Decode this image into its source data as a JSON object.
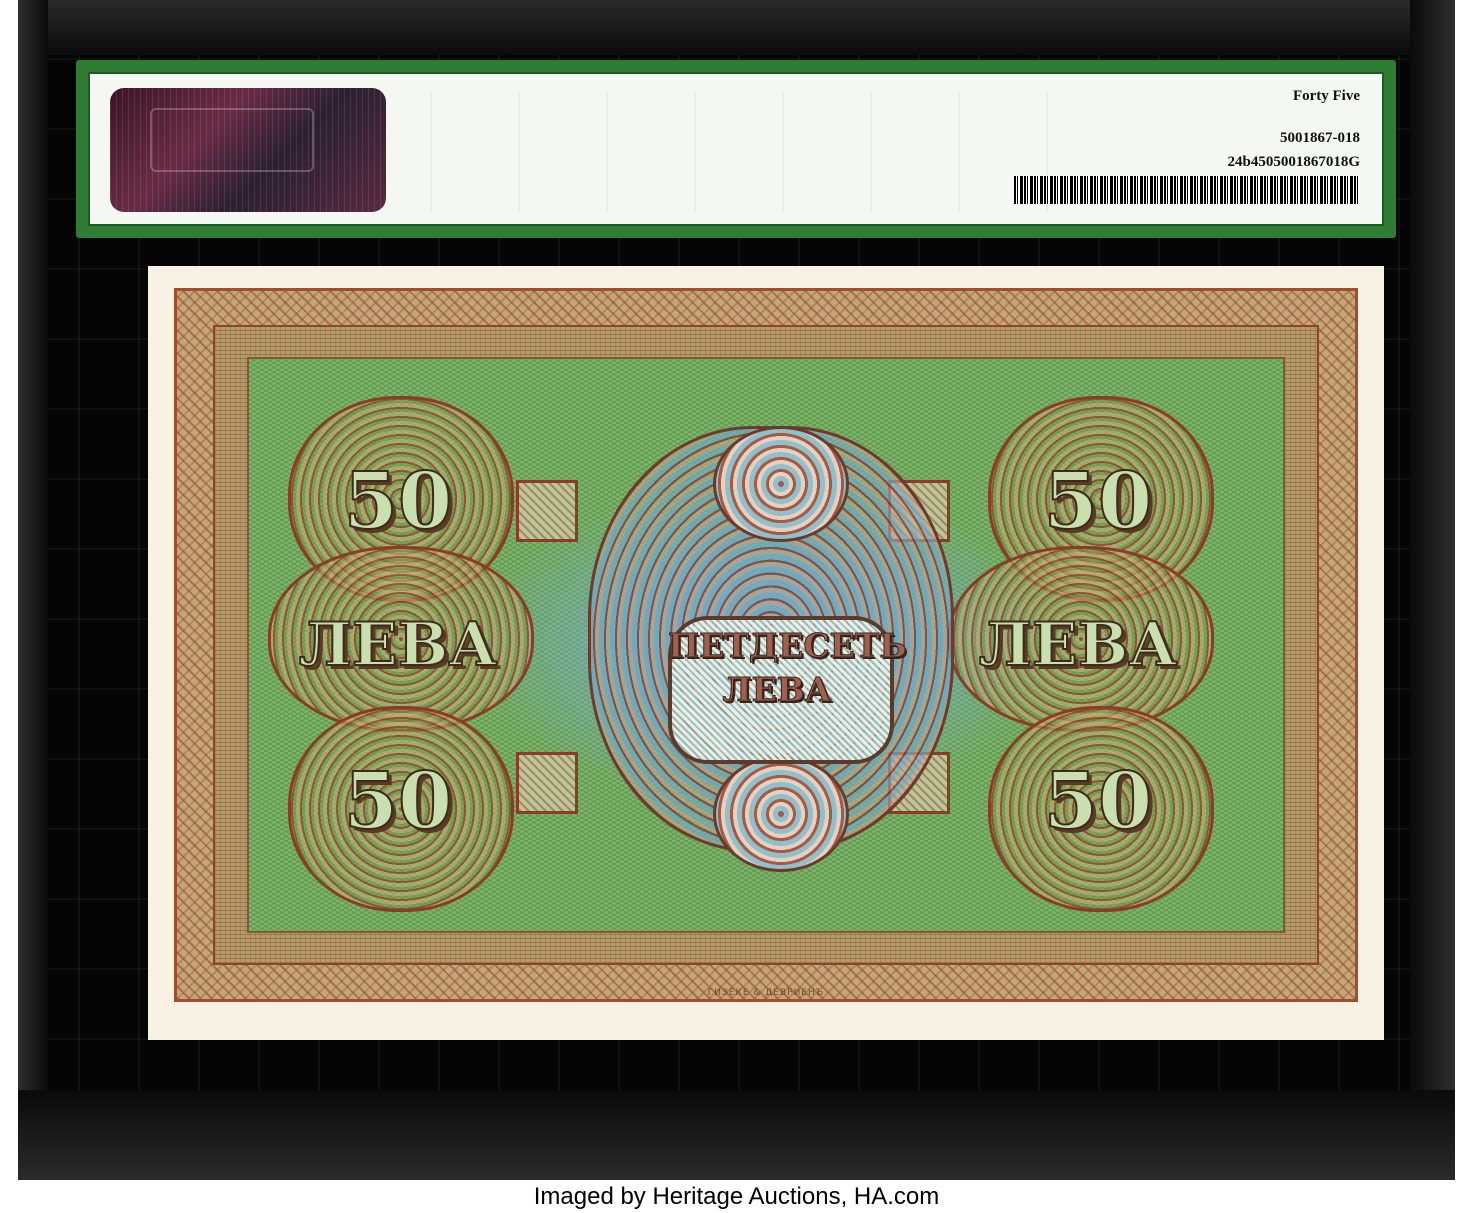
{
  "label": {
    "grade_text": "Forty Five",
    "cert_number": "5001867-018",
    "barcode_id": "24b4505001867018G"
  },
  "banknote": {
    "denomination_numeral": "50",
    "denomination_word": "ЛЕВА",
    "center_line_1": "ПЕТДЕСЕТЬ",
    "center_line_2": "ЛЕВА",
    "printer_imprint": "ГИЗЕКЕ & ДЕВРИЕНЪ"
  },
  "credit": "Imaged by Heritage Auctions, HA.com",
  "colors": {
    "label_green": "#2f7d33",
    "note_border_brown": "#a04e2c",
    "note_field_green": "#7fb46a",
    "note_center_blue": "#78aad2"
  }
}
